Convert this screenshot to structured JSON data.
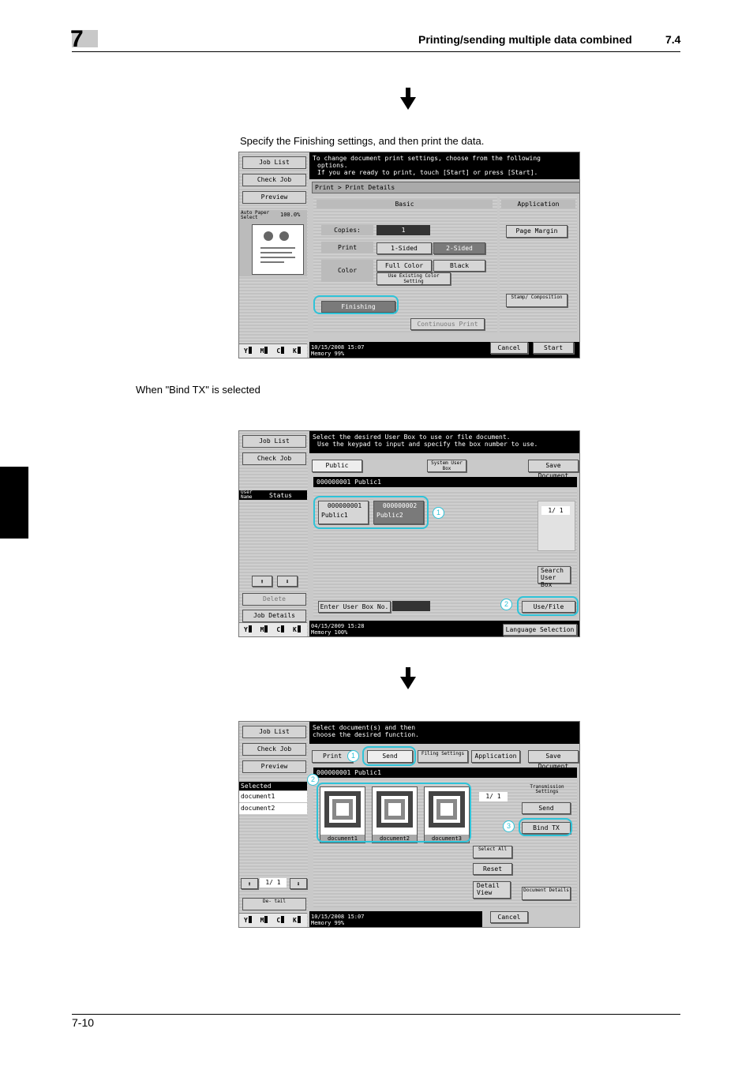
{
  "header": {
    "chapter": "7",
    "title": "Printing/sending multiple data combined",
    "section": "7.4"
  },
  "footer": {
    "page": "7-10"
  },
  "caption1": "Specify the Finishing settings, and then print the data.",
  "caption2": "When \"Bind TX\" is selected",
  "colors": {
    "highlight": "#2ec3d8",
    "panel": "#c9c9c9",
    "message_bar": "#000000"
  },
  "screen1": {
    "left_buttons": [
      "Job List",
      "Check Job",
      "Preview"
    ],
    "auto_paper": "Auto Paper Select",
    "zoom": "100.0%",
    "message": [
      "To change document print settings, choose from the following",
      "options.",
      "If you are ready to print, touch [Start] or press [Start]."
    ],
    "breadcrumb": "Print > Print Details",
    "tab_basic": "Basic",
    "tab_application": "Application",
    "copies_label": "Copies:",
    "copies_value": "1",
    "print_label": "Print",
    "sided1": "1-Sided",
    "sided2": "2-Sided",
    "color_label": "Color",
    "full_color": "Full Color",
    "black": "Black",
    "use_existing": "Use Existing Color Setting",
    "finishing": "Finishing",
    "continuous_print": "Continuous Print",
    "page_margin": "Page Margin",
    "stamp": "Stamp/ Composition",
    "datetime": "10/15/2008   15:07",
    "memory": "Memory        99%",
    "cancel": "Cancel",
    "start": "Start",
    "toner": [
      "Y",
      "M",
      "C",
      "K"
    ]
  },
  "screen2": {
    "left_buttons": [
      "Job List",
      "Check Job"
    ],
    "user_name": "User Name",
    "status": "Status",
    "delete": "Delete",
    "job_details": "Job Details",
    "message": [
      "Select the desired User Box to use or file document.",
      "Use the keypad to input and specify the box number to use."
    ],
    "tab_public": "Public",
    "tab_system": "System User Box",
    "save_document": "Save Document",
    "box_path": "000000001  Public1",
    "boxes": [
      {
        "number": "000000001",
        "name": "Public1"
      },
      {
        "number": "000000002",
        "name": "Public2"
      }
    ],
    "page": "1/  1",
    "search_user_box": "Search User Box",
    "enter_box_no": "Enter User Box No.",
    "use_file": "Use/File",
    "datetime": "04/15/2009   15:28",
    "memory": "Memory       100%",
    "language_selection": "Language Selection",
    "callouts": [
      "1",
      "2"
    ],
    "toner": [
      "Y",
      "M",
      "C",
      "K"
    ]
  },
  "screen3": {
    "left_buttons": [
      "Job List",
      "Check Job",
      "Preview"
    ],
    "selected_documents": "Selected Documents",
    "selected_list": [
      "document1",
      "document2"
    ],
    "left_page": "1/  1",
    "detail_btn": "De- tail",
    "message": [
      "Select document(s) and then",
      "choose the desired function."
    ],
    "tab_print": "Print",
    "tab_send": "Send",
    "tab_filing": "Filing Settings",
    "tab_application": "Application",
    "save_document": "Save Document",
    "box_path": "000000001  Public1",
    "documents": [
      "document1",
      "document2",
      "document3"
    ],
    "page": "1/  1",
    "transmission_settings": "Transmission Settings",
    "send_btn": "Send",
    "bind_tx": "Bind TX",
    "select_all": "Select All",
    "reset": "Reset",
    "detail_view": "Detail View",
    "document_details": "Document Details",
    "datetime": "10/15/2008   15:07",
    "memory": "Memory        99%",
    "cancel": "Cancel",
    "callouts": [
      "1",
      "2",
      "3"
    ],
    "toner": [
      "Y",
      "M",
      "C",
      "K"
    ]
  }
}
